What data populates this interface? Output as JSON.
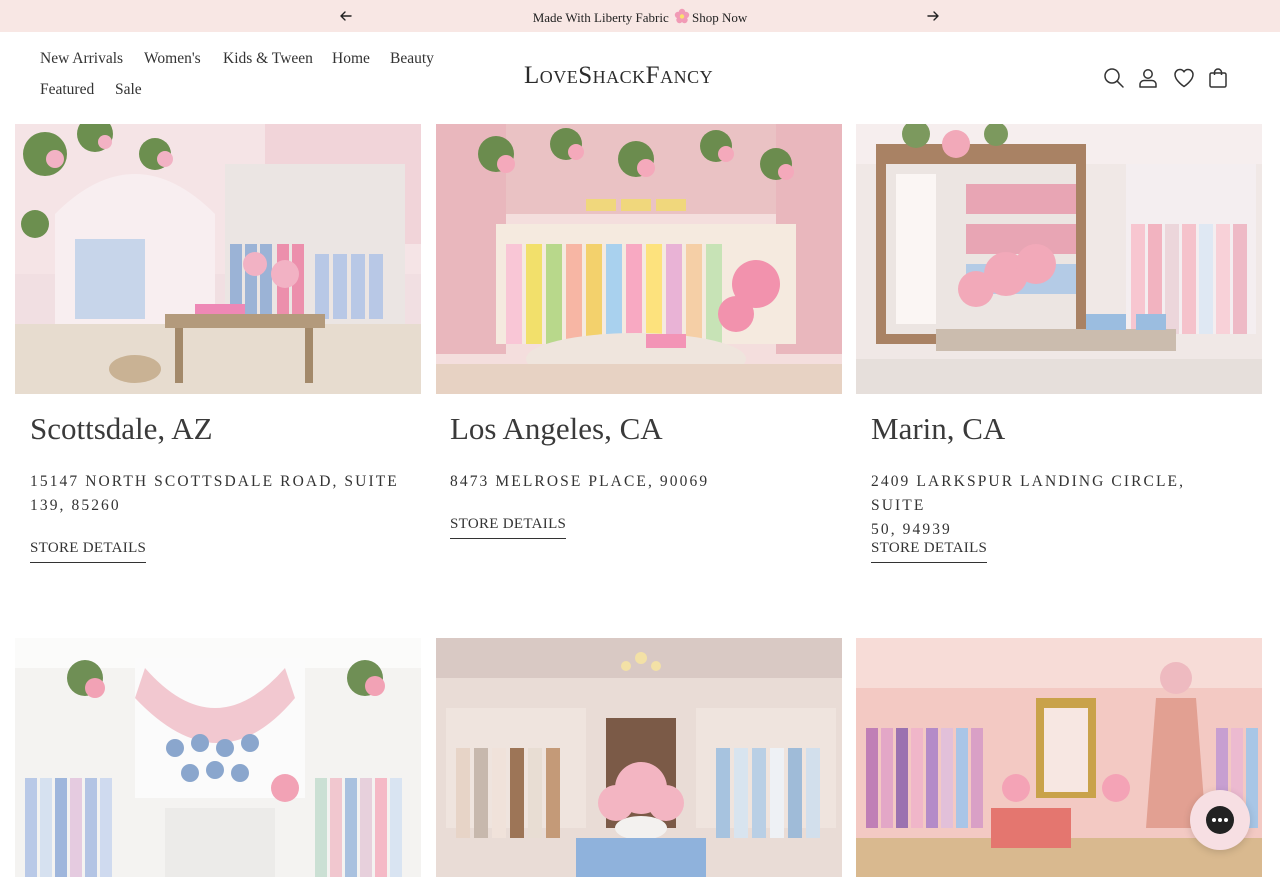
{
  "announcement": {
    "prev_label": "Previous",
    "next_label": "Next",
    "message": "Made With Liberty Fabric",
    "link": "Shop Now"
  },
  "nav": {
    "items": [
      "New Arrivals",
      "Women's",
      "Kids & Tween",
      "Home",
      "Beauty",
      "Featured",
      "Sale"
    ]
  },
  "brand": {
    "logo_text": "LoveShackFancy"
  },
  "header_icons": [
    "search-icon",
    "account-icon",
    "heart-icon",
    "bag-icon"
  ],
  "stores": [
    {
      "name": "Scottsdale, AZ",
      "address_line1": "15147 North Scottsdale Road, Suite",
      "address_line2": "139, 85260",
      "link": "STORE DETAILS"
    },
    {
      "name": "Los Angeles, CA",
      "address_line1": "8473 Melrose Place, 90069",
      "address_line2": "",
      "link": "STORE DETAILS"
    },
    {
      "name": "Marin, CA",
      "address_line1": "2409 Larkspur Landing Circle, Suite",
      "address_line2": "50, 94939",
      "link": "STORE DETAILS"
    }
  ],
  "colors": {
    "announcement_bg": "#f8e7e4",
    "text": "#333333",
    "chat_bg": "#f7dfe3",
    "store_pink": "#f2c9cf",
    "store_floral": "#e8a6b5"
  }
}
